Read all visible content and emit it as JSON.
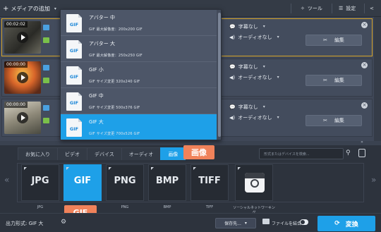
{
  "toolbar": {
    "add_media_label": "メディアの追加",
    "tools_label": "ツール",
    "settings_label": "設定"
  },
  "files": [
    {
      "time": "00:02:02",
      "subtitle": "字幕なし",
      "audio": "オーディオなし",
      "edit": "編集"
    },
    {
      "time": "00:00:00",
      "subtitle": "字幕なし",
      "audio": "オーディオなし",
      "edit": "編集"
    },
    {
      "time": "00:00:00",
      "subtitle": "字幕なし",
      "audio": "オーディオなし",
      "edit": "編集"
    }
  ],
  "dropdown": {
    "items": [
      {
        "title": "アバター 中",
        "desc": "GIF    最大解像度：200x200    GIF",
        "fmt": "GIF"
      },
      {
        "title": "アバター 大",
        "desc": "GIF    最大解像度：250x250    GIF",
        "fmt": "GIF"
      },
      {
        "title": "GIF 小",
        "desc": "GIF    サイズ変更 320x240    GIF",
        "fmt": "GIF"
      },
      {
        "title": "GIF 中",
        "desc": "GIF    サイズ変更 500x376    GIF",
        "fmt": "GIF"
      },
      {
        "title": "GIF 大",
        "desc": "GIF    サイズ変更 700x526    GIF",
        "fmt": "GIF"
      }
    ]
  },
  "tabs": [
    "お気に入り",
    "ビデオ",
    "デバイス",
    "オーディオ",
    "画像"
  ],
  "callouts": {
    "images": "画像",
    "gif": "GIF"
  },
  "search": {
    "placeholder": "形式またはデバイスを検索..."
  },
  "formats": [
    {
      "logo": "JPG",
      "label": "JPG"
    },
    {
      "logo": "GIF",
      "label": "GIF"
    },
    {
      "logo": "PNG",
      "label": "PNG"
    },
    {
      "logo": "BMP",
      "label": "BMP"
    },
    {
      "logo": "TIFF",
      "label": "TIFF"
    },
    {
      "logo": "",
      "label": "ソーシャルネットワーキング"
    }
  ],
  "footer": {
    "output_format": "出力形式: GIF 大",
    "save_to": "保存先...",
    "merge_files": "ファイルを結合",
    "convert": "変換"
  },
  "colors": {
    "accent": "#1ea0e8",
    "callout": "#f0825a",
    "selected_border": "#d7a62c"
  }
}
